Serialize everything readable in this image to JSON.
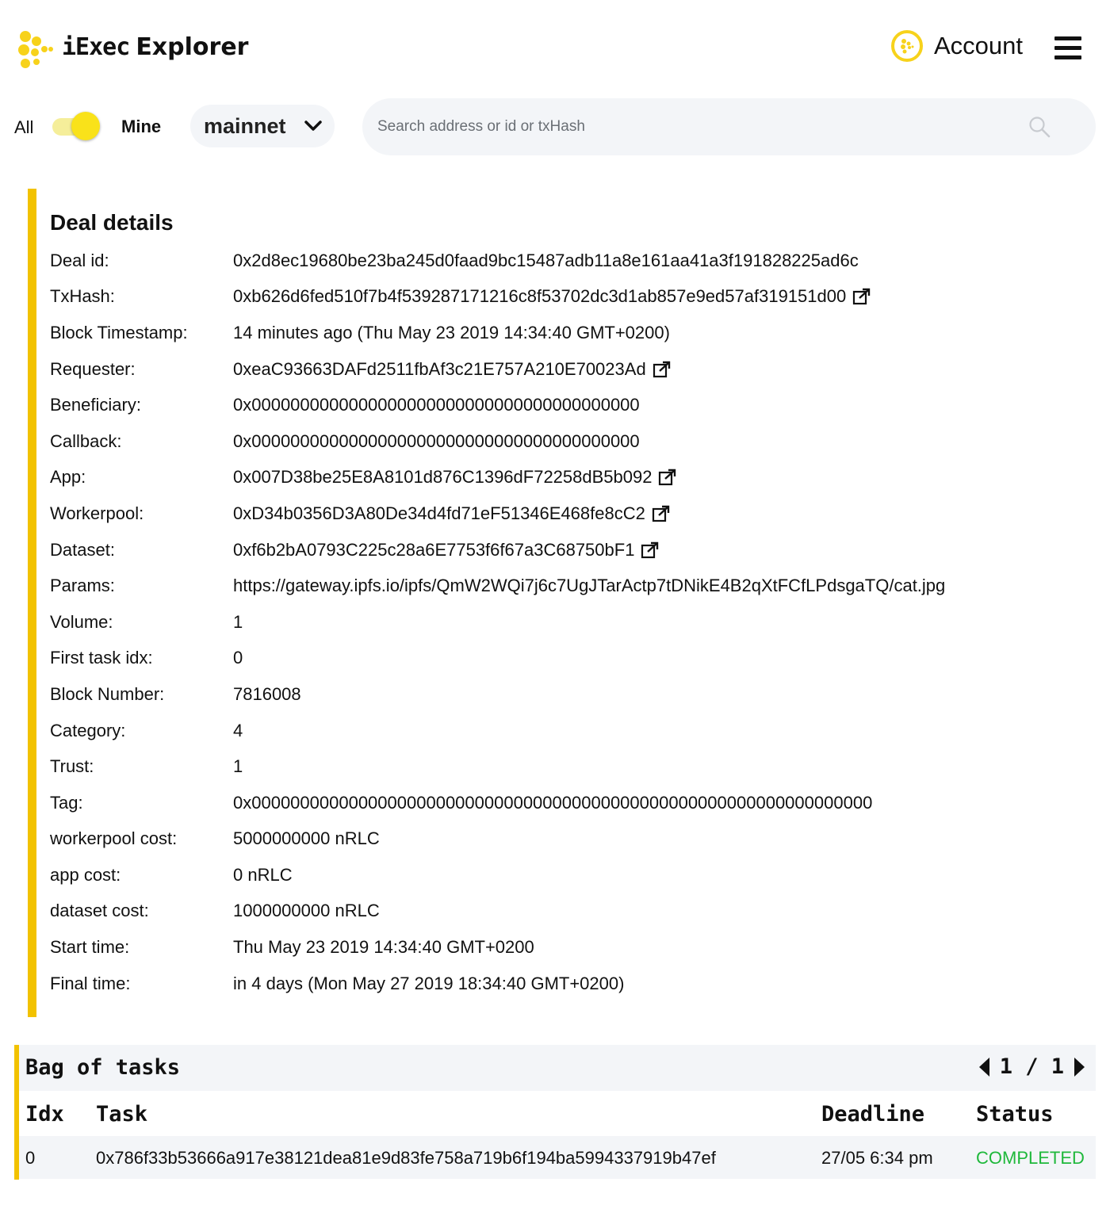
{
  "header": {
    "brand_part1": "iExec",
    "brand_part2": "Explorer",
    "account_label": "Account"
  },
  "filters": {
    "all_label": "All",
    "mine_label": "Mine",
    "network": "mainnet",
    "search_placeholder": "Search address or id or txHash"
  },
  "deal": {
    "title": "Deal details",
    "rows": [
      {
        "label": "Deal id:",
        "value": "0x2d8ec19680be23ba245d0faad9bc15487adb11a8e161aa41a3f191828225ad6c"
      },
      {
        "label": "TxHash:",
        "value": "0xb626d6fed510f7b4f539287171216c8f53702dc3d1ab857e9ed57af319151d00"
      },
      {
        "label": "Block Timestamp:",
        "value": "14 minutes ago (Thu May 23 2019 14:34:40 GMT+0200)"
      },
      {
        "label": "Requester:",
        "value": "0xeaC93663DAFd2511fbAf3c21E757A210E70023Ad"
      },
      {
        "label": "Beneficiary:",
        "value": "0x0000000000000000000000000000000000000000"
      },
      {
        "label": "Callback:",
        "value": "0x0000000000000000000000000000000000000000"
      },
      {
        "label": "App:",
        "value": "0x007D38be25E8A8101d876C1396dF72258dB5b092"
      },
      {
        "label": "Workerpool:",
        "value": "0xD34b0356D3A80De34d4fd71eF51346E468fe8cC2"
      },
      {
        "label": "Dataset:",
        "value": "0xf6b2bA0793C225c28a6E7753f6f67a3C68750bF1"
      },
      {
        "label": "Params:",
        "value": "https://gateway.ipfs.io/ipfs/QmW2WQi7j6c7UgJTarActp7tDNikE4B2qXtFCfLPdsgaTQ/cat.jpg"
      },
      {
        "label": "Volume:",
        "value": "1"
      },
      {
        "label": "First task idx:",
        "value": "0"
      },
      {
        "label": "Block Number:",
        "value": "7816008"
      },
      {
        "label": "Category:",
        "value": "4"
      },
      {
        "label": "Trust:",
        "value": "1"
      },
      {
        "label": "Tag:",
        "value": "0x0000000000000000000000000000000000000000000000000000000000000000"
      },
      {
        "label": "workerpool cost:",
        "value": "5000000000 nRLC"
      },
      {
        "label": "app cost:",
        "value": "0 nRLC"
      },
      {
        "label": "dataset cost:",
        "value": "1000000000 nRLC"
      },
      {
        "label": "Start time:",
        "value": "Thu May 23 2019 14:34:40 GMT+0200"
      },
      {
        "label": "Final time:",
        "value": "in 4 days (Mon May 27 2019 18:34:40 GMT+0200)"
      }
    ]
  },
  "bag": {
    "title": "Bag of tasks",
    "pager": "1 / 1",
    "columns": [
      "Idx",
      "Task",
      "Deadline",
      "Status"
    ],
    "rows": [
      {
        "idx": "0",
        "task": "0x786f33b53666a917e38121dea81e9d83fe758a719b6f194ba5994337919b47ef",
        "deadline": "27/05 6:34 pm",
        "status": "COMPLETED"
      }
    ]
  },
  "colors": {
    "accent": "#f2c200",
    "status_completed": "#1fb83b"
  },
  "icons": [
    "iexec-logo-icon",
    "account-icon",
    "menu-icon",
    "chevron-down-icon",
    "search-icon",
    "external-link-icon",
    "caret-left-icon",
    "caret-right-icon"
  ]
}
